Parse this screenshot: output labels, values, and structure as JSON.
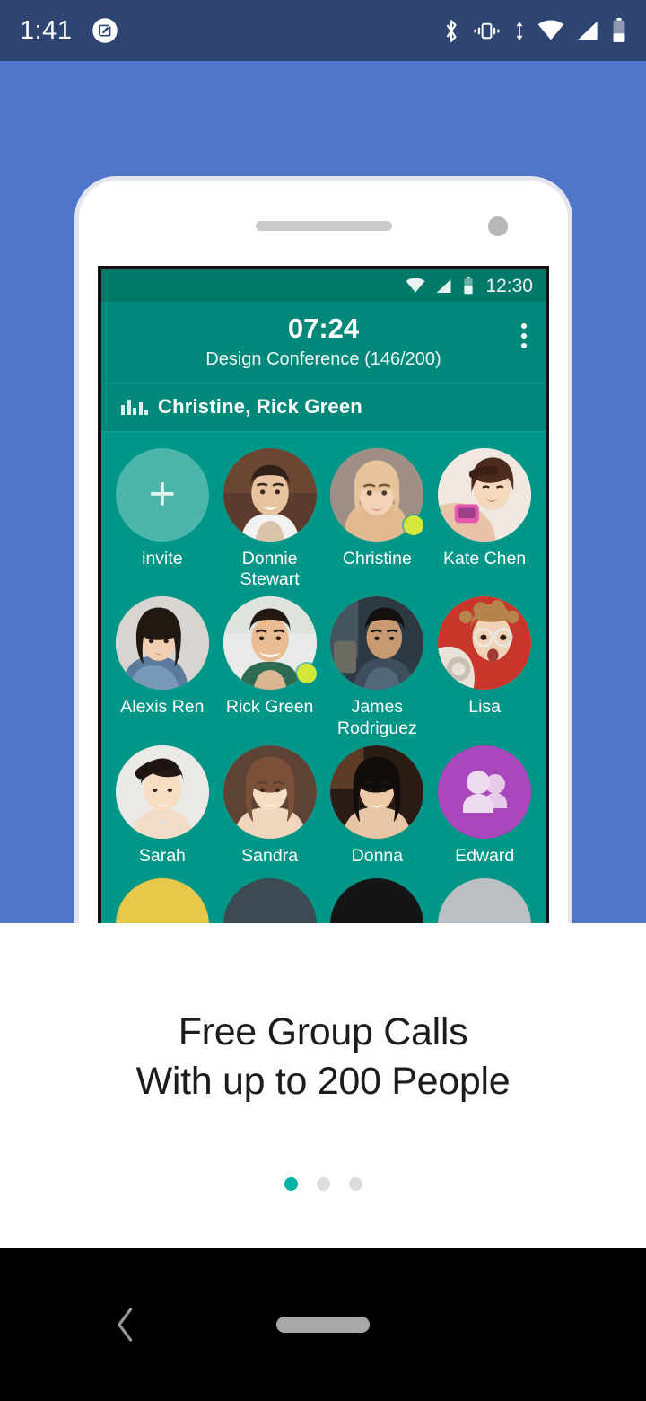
{
  "os_status_bar": {
    "clock": "1:41",
    "left_icons": [
      "screenshot-icon"
    ],
    "right_icons": [
      "bluetooth-icon",
      "vibrate-icon",
      "data-transfer-icon",
      "wifi-icon",
      "cellular-signal-icon",
      "battery-icon"
    ],
    "background_color": "#2e4572"
  },
  "hero": {
    "background_color": "#4f76c8",
    "phone": {
      "frame_color": "#ffffff",
      "screen": {
        "background_color": "#009688",
        "status_bar": {
          "clock": "12:30",
          "icons": [
            "wifi-icon",
            "cellular-signal-icon",
            "battery-icon"
          ],
          "background_color": "#00796b"
        },
        "app_header": {
          "timer": "07:24",
          "subtitle": "Design Conference (146/200)",
          "overflow_menu": "more-options",
          "background_color": "#00897b"
        },
        "speaking_bar": {
          "icon": "equalizer-icon",
          "label": "Christine, Rick Green"
        },
        "participants": [
          {
            "name": "invite",
            "type": "invite",
            "online": false
          },
          {
            "name": "Donnie Stewart",
            "type": "photo",
            "online": false,
            "photo": "man-white-shirt"
          },
          {
            "name": "Christine",
            "type": "photo",
            "online": true,
            "photo": "blonde-woman"
          },
          {
            "name": "Kate Chen",
            "type": "photo",
            "online": false,
            "photo": "woman-pink-phone"
          },
          {
            "name": "Alexis Ren",
            "type": "photo",
            "online": false,
            "photo": "woman-denim"
          },
          {
            "name": "Rick Green",
            "type": "photo",
            "online": true,
            "photo": "smiling-man"
          },
          {
            "name": "James Rodriguez",
            "type": "photo",
            "online": false,
            "photo": "man-dark-jacket"
          },
          {
            "name": "Lisa",
            "type": "photo",
            "online": false,
            "photo": "woman-glasses-red"
          },
          {
            "name": "Sarah",
            "type": "photo",
            "online": false,
            "photo": "short-hair-woman"
          },
          {
            "name": "Sandra",
            "type": "photo",
            "online": false,
            "photo": "brown-wavy-hair"
          },
          {
            "name": "Donna",
            "type": "photo",
            "online": false,
            "photo": "dark-hair-woman"
          },
          {
            "name": "Edward",
            "type": "group",
            "online": false,
            "photo": "group-icon"
          }
        ],
        "partial_row": [
          {
            "color": "#e8c84a"
          },
          {
            "color": "#3c4a52"
          },
          {
            "color": "#151515"
          },
          {
            "color": "#b9bfc2"
          }
        ],
        "online_dot_color": "#d4e83a"
      }
    }
  },
  "caption": {
    "line1": "Free Group Calls",
    "line2": "With up to 200 People"
  },
  "pager": {
    "total": 3,
    "active_index": 0,
    "active_color": "#00b3a4",
    "inactive_color": "#dcdcdc"
  },
  "nav_bar": {
    "back": "back-chevron",
    "home": "home-pill",
    "background_color": "#000000"
  }
}
